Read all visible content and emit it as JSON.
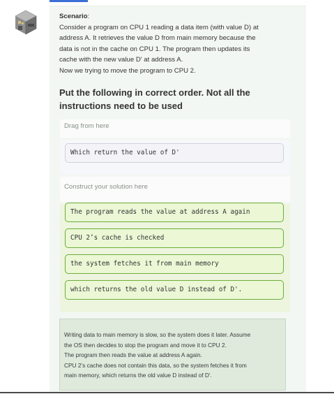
{
  "scenario": {
    "heading": "Scenario",
    "heading_suffix": ":",
    "lines": [
      "Consider a program on CPU 1 reading a data item (with value D) at",
      "address A. It retrieves the value D from main memory because the",
      "data is not in the cache on CPU 1. The program then updates its",
      "cache with the new value D' at address A.",
      "Now we trying to move the program to CPU 2."
    ]
  },
  "question": {
    "lines": [
      "Put the following in correct order. Not all the",
      "instructions need to be used"
    ]
  },
  "source": {
    "label": "Drag from here",
    "blocks": [
      "Which return the value of D'"
    ]
  },
  "solution": {
    "label": "Construct your solution here",
    "blocks": [
      "The program reads the value at address A again",
      "CPU 2’s cache is checked",
      "the system fetches it from main memory",
      "which returns the old value D instead of D'."
    ]
  },
  "feedback": {
    "lines": [
      "Writing data to main memory is slow, so the system does it later. Assume",
      "the OS then decides to stop the program and move it to CPU 2.",
      "The program then reads the value at address A again.",
      "CPU 2’s cache does not contain this data, so the system fetches it from",
      "main memory, which returns the old value D instead of D'."
    ]
  },
  "colors": {
    "accent": "#3b6fd6",
    "solution_block_border": "#6dad3a",
    "solution_block_fill": "#ebf7d5",
    "feedback_fill": "#dfeadd"
  },
  "icons": {
    "avatar": "pixel-robot-avatar"
  }
}
